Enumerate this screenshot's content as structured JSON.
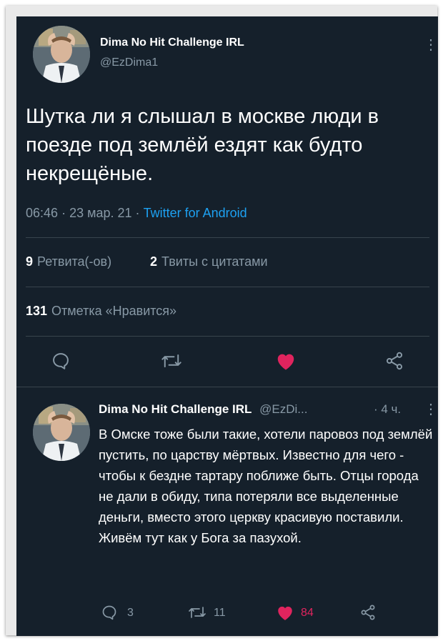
{
  "tweet": {
    "author_name": "Dima No Hit Challenge IRL",
    "handle": "@EzDima1",
    "text": "Шутка ли я слышал в москве люди в поезде под землёй ездят как будто некрещёные.",
    "time": "06:46",
    "date": "23 мар. 21",
    "separator": "·",
    "client": "Twitter for Android",
    "retweets_count": "9",
    "retweets_label": "Ретвита(-ов)",
    "quotes_count": "2",
    "quotes_label": "Твиты с цитатами",
    "likes_count": "131",
    "likes_label": "Отметка «Нравится»"
  },
  "reply": {
    "author_name": "Dima No Hit Challenge IRL",
    "handle": "@EzDi...",
    "age": "· 4 ч.",
    "text": "В Омске тоже были такие, хотели паровоз под землёй пустить, по царству мёртвых. Известно для чего - чтобы к бездне тартару поближе быть. Отцы города не дали в обиду, типа потеряли все выделенные деньги, вместо этого церкву красивую поставили. Живём тут как у Бога за пазухой.",
    "reply_count": "3",
    "retweet_count": "11",
    "like_count": "84"
  },
  "icons": {
    "reply": "reply-icon",
    "retweet": "retweet-icon",
    "like": "heart-icon",
    "share": "share-icon",
    "more": "more-vertical-icon"
  },
  "colors": {
    "background": "#15202b",
    "text": "#ffffff",
    "muted": "#8899a6",
    "link": "#1da1f2",
    "like": "#e0245e",
    "divider": "#38444d"
  }
}
